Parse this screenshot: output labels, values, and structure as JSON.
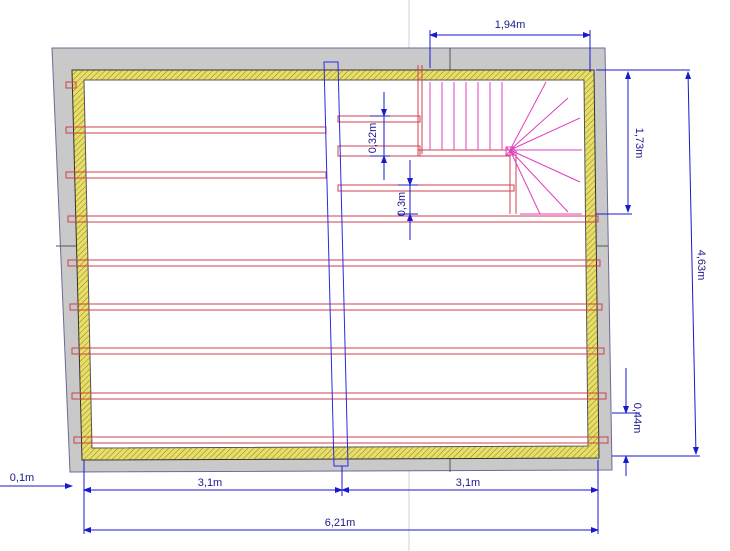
{
  "drawing": {
    "dimensions": {
      "stair_width": "1,94m",
      "stair_length": "1,73m",
      "total_depth": "4,63m",
      "step_depth_1": "0,32m",
      "step_depth_2": "0,3m",
      "offset_right": "0,44m",
      "wall_offset": "0,1m",
      "span_left": "3,1m",
      "span_right": "3,1m",
      "total_width": "6,21m"
    },
    "colors": {
      "slab": "#c8c8c8",
      "wall_hatch": "#e8e070",
      "beam": "#d04050",
      "dimension": "#1a1acc",
      "stair": "#e040c0"
    }
  }
}
